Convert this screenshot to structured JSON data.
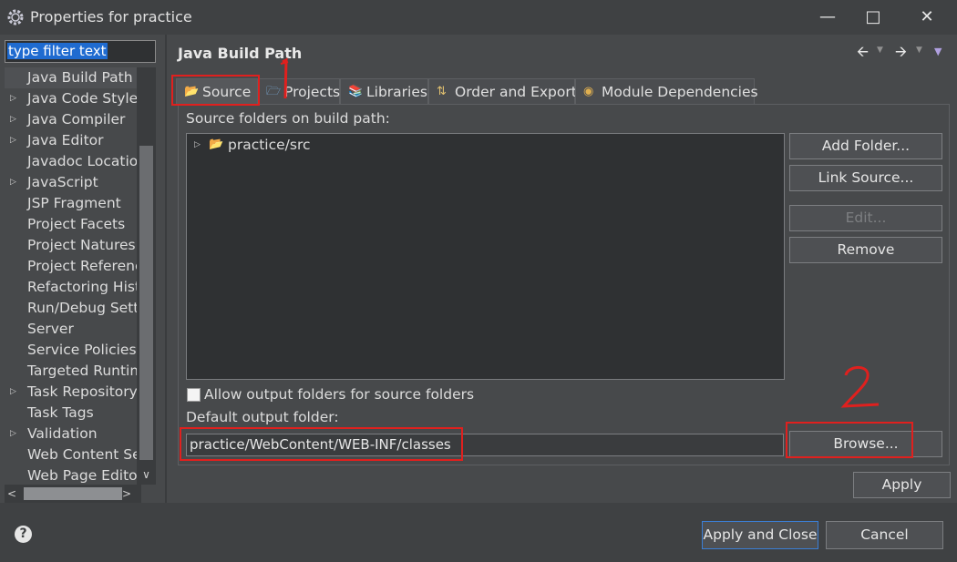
{
  "window": {
    "title": "Properties for practice"
  },
  "filter": {
    "value": "type filter text"
  },
  "tree": {
    "items": [
      {
        "label": "Java Build Path",
        "expandable": false,
        "selected": true
      },
      {
        "label": "Java Code Style",
        "expandable": true
      },
      {
        "label": "Java Compiler",
        "expandable": true
      },
      {
        "label": "Java Editor",
        "expandable": true
      },
      {
        "label": "Javadoc Location",
        "expandable": false
      },
      {
        "label": "JavaScript",
        "expandable": true
      },
      {
        "label": "JSP Fragment",
        "expandable": false
      },
      {
        "label": "Project Facets",
        "expandable": false
      },
      {
        "label": "Project Natures",
        "expandable": false
      },
      {
        "label": "Project References",
        "expandable": false
      },
      {
        "label": "Refactoring History",
        "expandable": false
      },
      {
        "label": "Run/Debug Settings",
        "expandable": false
      },
      {
        "label": "Server",
        "expandable": false
      },
      {
        "label": "Service Policies",
        "expandable": false
      },
      {
        "label": "Targeted Runtimes",
        "expandable": false
      },
      {
        "label": "Task Repository",
        "expandable": true
      },
      {
        "label": "Task Tags",
        "expandable": false
      },
      {
        "label": "Validation",
        "expandable": true
      },
      {
        "label": "Web Content Settings",
        "expandable": false
      },
      {
        "label": "Web Page Editor",
        "expandable": false
      }
    ]
  },
  "page": {
    "title": "Java Build Path"
  },
  "tabs": [
    {
      "label": "Source",
      "icon": "source-icon",
      "active": true
    },
    {
      "label": "Projects",
      "icon": "projects-icon"
    },
    {
      "label": "Libraries",
      "icon": "libraries-icon"
    },
    {
      "label": "Order and Export",
      "icon": "order-icon"
    },
    {
      "label": "Module Dependencies",
      "icon": "module-icon"
    }
  ],
  "source": {
    "label": "Source folders on build path:",
    "folder": "practice/src",
    "buttons": {
      "add": "Add Folder...",
      "link": "Link Source...",
      "edit": "Edit...",
      "remove": "Remove"
    },
    "allow_output_label": "Allow output folders for source folders",
    "allow_output_checked": false,
    "output_label": "Default output folder:",
    "output_value": "practice/WebContent/WEB-INF/classes",
    "browse": "Browse..."
  },
  "actions": {
    "apply": "Apply",
    "apply_close": "Apply and Close",
    "cancel": "Cancel"
  },
  "annotations": {
    "mark1": "1",
    "mark2": "2",
    "color": "#e0201e"
  }
}
